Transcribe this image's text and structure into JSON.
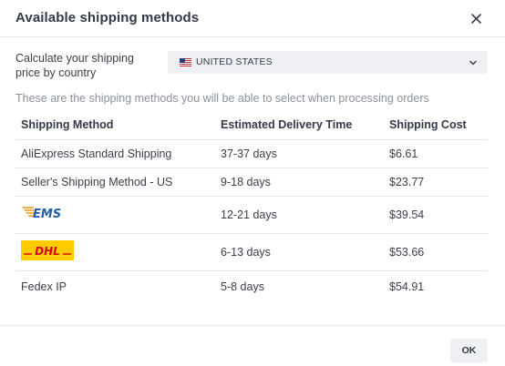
{
  "dialog": {
    "title": "Available shipping methods"
  },
  "country": {
    "label": "Calculate your shipping price by country",
    "selected": "UNITED STATES"
  },
  "info_text": "These are the shipping methods you will be able to select when processing orders",
  "table": {
    "headers": [
      "Shipping Method",
      "Estimated Delivery Time",
      "Shipping Cost"
    ],
    "rows": [
      {
        "method": "AliExpress Standard Shipping",
        "logo": "",
        "time": "37-37 days",
        "cost": "$6.61"
      },
      {
        "method": "Seller's Shipping Method - US",
        "logo": "",
        "time": "9-18 days",
        "cost": "$23.77"
      },
      {
        "method": "",
        "logo": "EMS",
        "time": "12-21 days",
        "cost": "$39.54"
      },
      {
        "method": "",
        "logo": "DHL",
        "time": "6-13 days",
        "cost": "$53.66"
      },
      {
        "method": "Fedex IP",
        "logo": "",
        "time": "5-8 days",
        "cost": "$54.91"
      }
    ]
  },
  "footer": {
    "ok_label": "OK"
  },
  "colors": {
    "ems_blue": "#1f5fae",
    "ems_orange": "#f39a1d",
    "dhl_yellow": "#ffcc00",
    "dhl_red": "#d40511",
    "select_bg": "#eef0f4"
  },
  "icons": {
    "close": "close-icon",
    "chevron": "chevron-down-icon",
    "flag": "us-flag-icon"
  }
}
